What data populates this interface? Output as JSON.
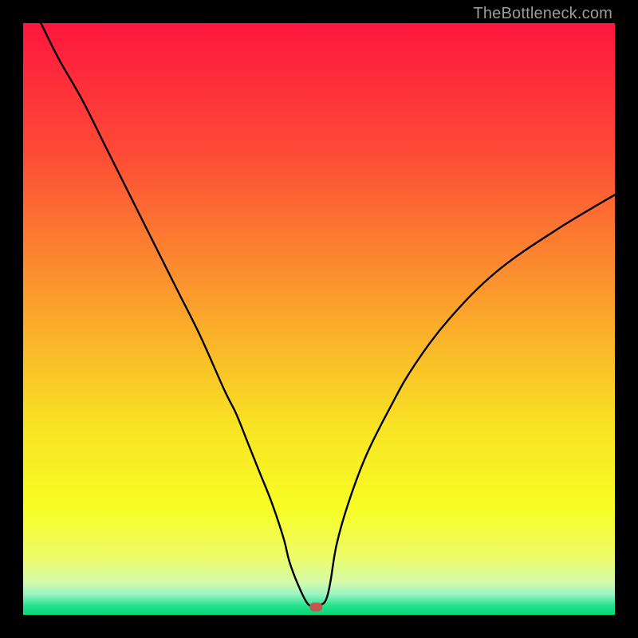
{
  "watermark": "TheBottleneck.com",
  "chart_data": {
    "type": "line",
    "title": "",
    "xlabel": "",
    "ylabel": "",
    "xlim": [
      0,
      100
    ],
    "ylim": [
      0,
      100
    ],
    "series": [
      {
        "name": "bottleneck-curve",
        "x": [
          3,
          6,
          10,
          14,
          18,
          22,
          26,
          30,
          34,
          36,
          38,
          40,
          42,
          44,
          45,
          46.5,
          48,
          49,
          50,
          50.5,
          51,
          51.5,
          52,
          53,
          55,
          58,
          62,
          66,
          72,
          80,
          90,
          100
        ],
        "y": [
          100,
          94,
          87,
          79,
          71,
          63,
          55,
          47,
          38,
          34,
          29,
          24,
          19,
          13,
          9,
          5,
          2,
          1.5,
          1.5,
          1.8,
          2.2,
          3.5,
          6,
          12,
          19,
          27,
          35,
          42,
          50,
          58,
          65,
          71
        ]
      }
    ],
    "marker": {
      "x": 49.5,
      "y": 1.4
    },
    "background": {
      "type": "vertical-gradient",
      "stops": [
        {
          "pos": 0.0,
          "color": "#fe163e"
        },
        {
          "pos": 0.22,
          "color": "#fd4b36"
        },
        {
          "pos": 0.45,
          "color": "#fb982d"
        },
        {
          "pos": 0.68,
          "color": "#f8e324"
        },
        {
          "pos": 0.82,
          "color": "#f7fd24"
        },
        {
          "pos": 0.9,
          "color": "#eefc65"
        },
        {
          "pos": 0.945,
          "color": "#d4fbac"
        },
        {
          "pos": 0.965,
          "color": "#9af5c3"
        },
        {
          "pos": 0.985,
          "color": "#22e28c"
        },
        {
          "pos": 1.0,
          "color": "#08d673"
        }
      ]
    }
  }
}
